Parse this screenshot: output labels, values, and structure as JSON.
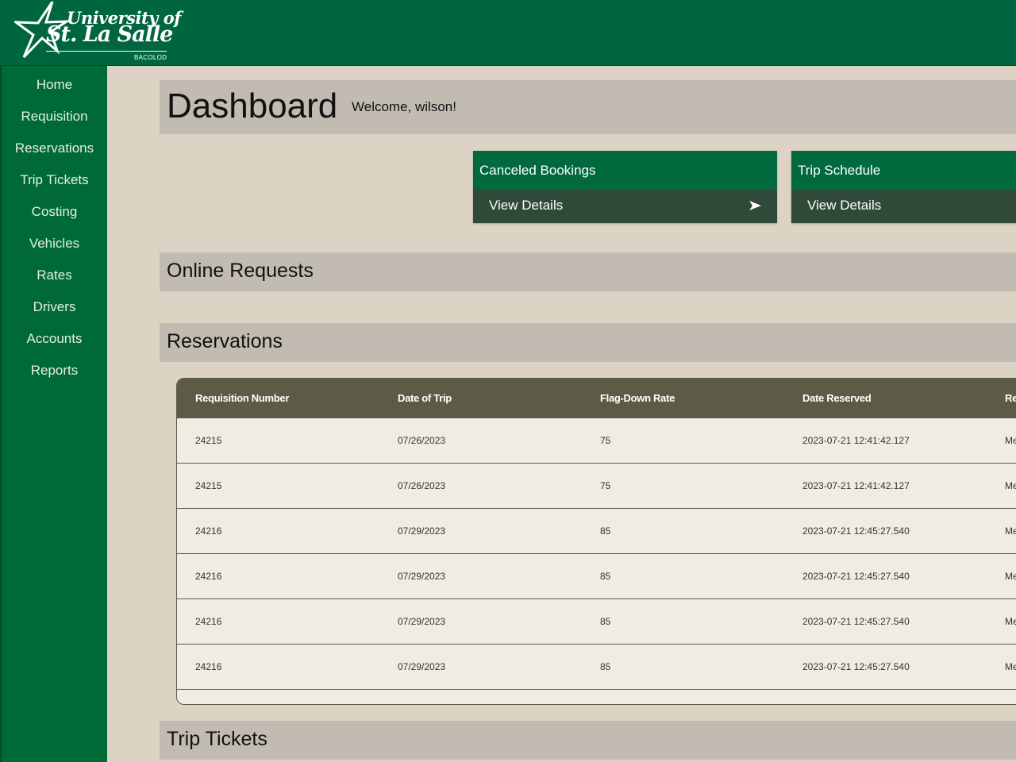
{
  "logo": {
    "line1": "University of",
    "line2": "St. La Salle",
    "line3": "BACOLOD"
  },
  "sidebar": {
    "items": [
      {
        "label": "Home"
      },
      {
        "label": "Requisition"
      },
      {
        "label": "Reservations"
      },
      {
        "label": "Trip Tickets"
      },
      {
        "label": "Costing"
      },
      {
        "label": "Vehicles"
      },
      {
        "label": "Rates"
      },
      {
        "label": "Drivers"
      },
      {
        "label": "Accounts"
      },
      {
        "label": "Reports"
      }
    ]
  },
  "header": {
    "title": "Dashboard",
    "welcome": "Welcome, wilson!"
  },
  "cards": [
    {
      "title": "Canceled Bookings",
      "action": "View Details"
    },
    {
      "title": "Trip Schedule",
      "action": "View Details"
    }
  ],
  "sections": {
    "online_requests": "Online Requests",
    "reservations": "Reservations",
    "trip_tickets": "Trip Tickets"
  },
  "table": {
    "headers": [
      "Requisition Number",
      "Date of Trip",
      "Flag-Down Rate",
      "Date Reserved",
      "Re"
    ],
    "rows": [
      [
        "24215",
        "07/26/2023",
        "75",
        "2023-07-21 12:41:42.127",
        "Me"
      ],
      [
        "24215",
        "07/26/2023",
        "75",
        "2023-07-21 12:41:42.127",
        "Me"
      ],
      [
        "24216",
        "07/29/2023",
        "85",
        "2023-07-21 12:45:27.540",
        "Me"
      ],
      [
        "24216",
        "07/29/2023",
        "85",
        "2023-07-21 12:45:27.540",
        "Me"
      ],
      [
        "24216",
        "07/29/2023",
        "85",
        "2023-07-21 12:45:27.540",
        "Me"
      ],
      [
        "24216",
        "07/29/2023",
        "85",
        "2023-07-21 12:45:27.540",
        "Me"
      ]
    ]
  },
  "colors": {
    "brand_green": "#006640",
    "sidebar_green": "#006a36",
    "card_dark": "#2f4a38",
    "table_header": "#5d5b46",
    "page_bg": "#dcd3c4",
    "section_bar": "#c1bbb2"
  }
}
